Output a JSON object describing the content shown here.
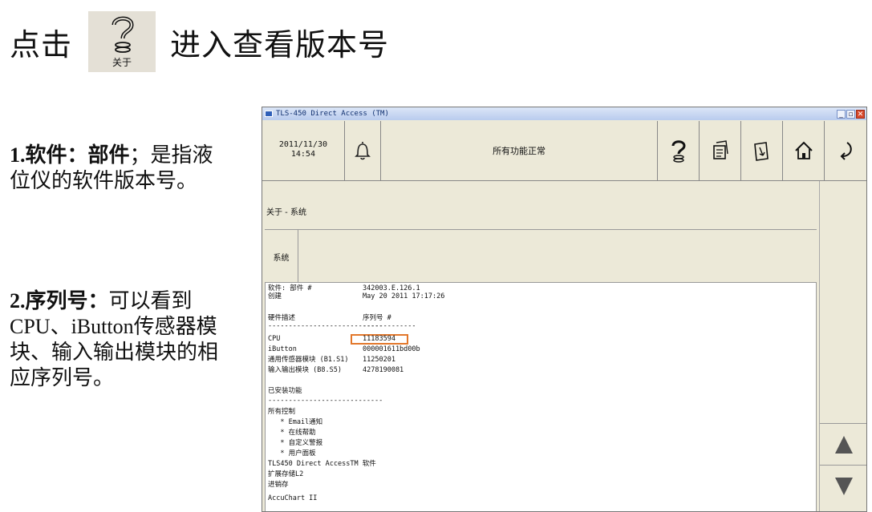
{
  "slide": {
    "heading_before": "点击",
    "heading_icon_label": "关于",
    "heading_after": "进入查看版本号",
    "note1_bold": "1.软件：部件",
    "note1_text": "；是指液位仪的软件版本号。",
    "note2_bold": "2.序列号：",
    "note2_text": "可以看到CPU、iButton传感器模块、输入输出模块的相应序列号。"
  },
  "window": {
    "title": "TLS-450 Direct Access (TM)",
    "date": "2011/11/30",
    "time": "14:54",
    "status": "所有功能正常",
    "breadcrumb": "关于 - 系统",
    "tab": "系统",
    "rows": [
      {
        "a": "软件: 部件 #",
        "b": "342003.E.126.1"
      },
      {
        "a": "创建",
        "b": "May 20 2011 17:17:26"
      },
      {
        "a": "",
        "b": ""
      },
      {
        "a": "硬件描述",
        "b": "序列号 #"
      },
      {
        "a": "----------------------------",
        "b": "-------------"
      },
      {
        "a": "CPU",
        "b": "11183594"
      },
      {
        "a": "iButton",
        "b": "000001611bd00b"
      },
      {
        "a": "通用传感器模块 (B1.S1)",
        "b": "11250201"
      },
      {
        "a": "输入输出模块 (B8.S5)",
        "b": "4278190081"
      },
      {
        "a": "",
        "b": ""
      },
      {
        "a": "已安装功能",
        "b": ""
      },
      {
        "a": "----------------------------",
        "b": ""
      },
      {
        "a": "所有控制",
        "b": ""
      },
      {
        "a": "   * Email通知",
        "b": ""
      },
      {
        "a": "   * 在线帮助",
        "b": ""
      },
      {
        "a": "   * 自定义警报",
        "b": ""
      },
      {
        "a": "   * 用户面板",
        "b": ""
      },
      {
        "a": "TLS450 Direct AccessTM 软件",
        "b": ""
      },
      {
        "a": "扩展存储L2",
        "b": ""
      },
      {
        "a": "进销存",
        "b": ""
      },
      {
        "a": "AccuChart II",
        "b": ""
      }
    ]
  },
  "icons": [
    "question-mark-icon",
    "bell-icon",
    "help-icon",
    "report-icon",
    "edit-icon",
    "home-icon",
    "back-icon",
    "arrow-up-icon",
    "arrow-down-icon"
  ],
  "colors": {
    "highlight": "#e2772b",
    "panel": "#ece9d8",
    "titlebar": "#b9cbee"
  }
}
